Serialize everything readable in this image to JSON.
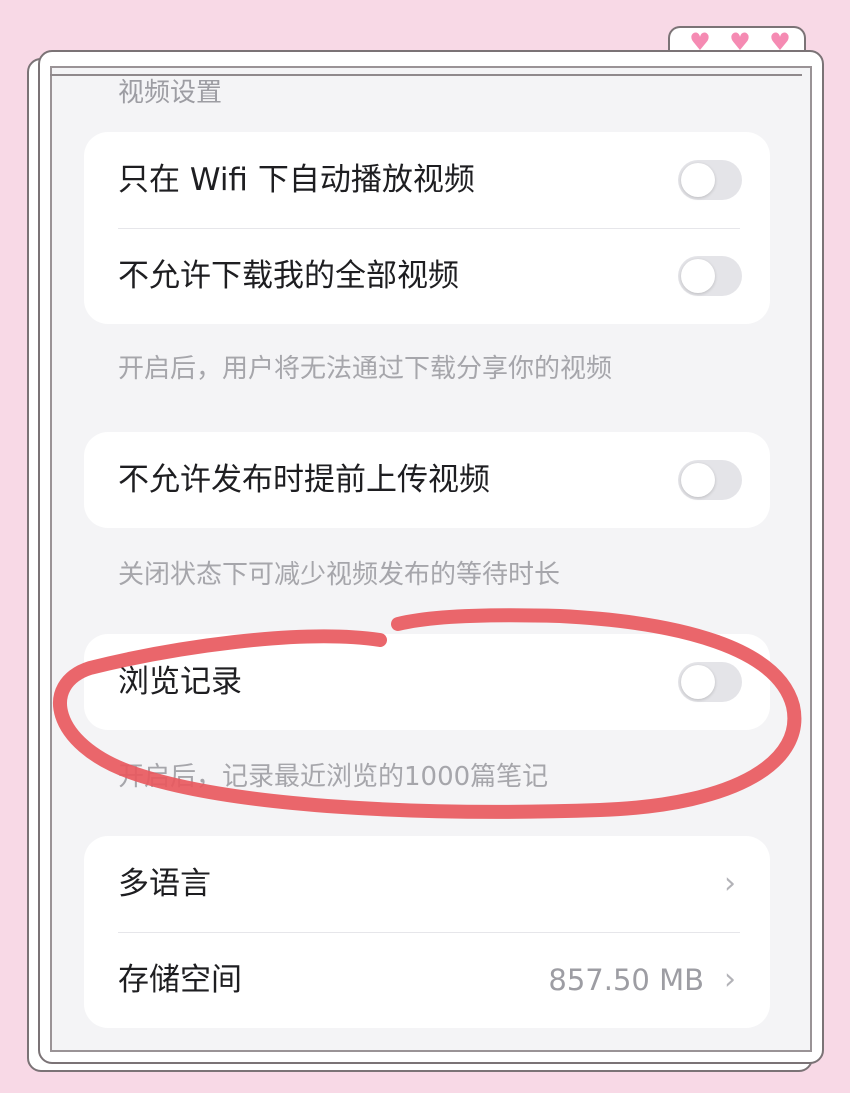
{
  "frame": {
    "hearts": [
      "♥",
      "♥",
      "♥"
    ],
    "accent_color": "#f58bb3",
    "background_color": "#f8d9e6"
  },
  "settings": {
    "section_title": "视频设置",
    "video_card": {
      "autoplay_wifi": {
        "label": "只在 Wifi 下自动播放视频",
        "enabled": false
      },
      "disallow_download": {
        "label": "不允许下载我的全部视频",
        "enabled": false
      }
    },
    "download_note": "开启后，用户将无法通过下载分享你的视频",
    "upload_card": {
      "disallow_pre_upload": {
        "label": "不允许发布时提前上传视频",
        "enabled": false
      }
    },
    "upload_note": "关闭状态下可减少视频发布的等待时长",
    "history_card": {
      "browse_history": {
        "label": "浏览记录",
        "enabled": false
      }
    },
    "history_note": "开启后，记录最近浏览的1000篇笔记",
    "misc_card": {
      "language": {
        "label": "多语言"
      },
      "storage": {
        "label": "存储空间",
        "value": "857.50 MB"
      }
    },
    "chevron": "›"
  },
  "annotation": {
    "circle_color": "#e8595e"
  }
}
